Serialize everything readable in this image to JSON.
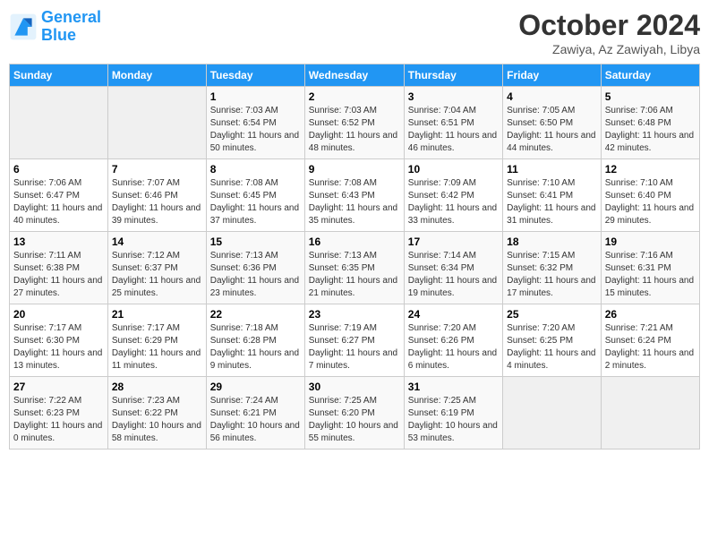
{
  "header": {
    "logo_line1": "General",
    "logo_line2": "Blue",
    "month_title": "October 2024",
    "subtitle": "Zawiya, Az Zawiyah, Libya"
  },
  "days_of_week": [
    "Sunday",
    "Monday",
    "Tuesday",
    "Wednesday",
    "Thursday",
    "Friday",
    "Saturday"
  ],
  "weeks": [
    [
      {
        "day": "",
        "info": ""
      },
      {
        "day": "",
        "info": ""
      },
      {
        "day": "1",
        "sunrise": "7:03 AM",
        "sunset": "6:54 PM",
        "daylight": "11 hours and 50 minutes."
      },
      {
        "day": "2",
        "sunrise": "7:03 AM",
        "sunset": "6:52 PM",
        "daylight": "11 hours and 48 minutes."
      },
      {
        "day": "3",
        "sunrise": "7:04 AM",
        "sunset": "6:51 PM",
        "daylight": "11 hours and 46 minutes."
      },
      {
        "day": "4",
        "sunrise": "7:05 AM",
        "sunset": "6:50 PM",
        "daylight": "11 hours and 44 minutes."
      },
      {
        "day": "5",
        "sunrise": "7:06 AM",
        "sunset": "6:48 PM",
        "daylight": "11 hours and 42 minutes."
      }
    ],
    [
      {
        "day": "6",
        "sunrise": "7:06 AM",
        "sunset": "6:47 PM",
        "daylight": "11 hours and 40 minutes."
      },
      {
        "day": "7",
        "sunrise": "7:07 AM",
        "sunset": "6:46 PM",
        "daylight": "11 hours and 39 minutes."
      },
      {
        "day": "8",
        "sunrise": "7:08 AM",
        "sunset": "6:45 PM",
        "daylight": "11 hours and 37 minutes."
      },
      {
        "day": "9",
        "sunrise": "7:08 AM",
        "sunset": "6:43 PM",
        "daylight": "11 hours and 35 minutes."
      },
      {
        "day": "10",
        "sunrise": "7:09 AM",
        "sunset": "6:42 PM",
        "daylight": "11 hours and 33 minutes."
      },
      {
        "day": "11",
        "sunrise": "7:10 AM",
        "sunset": "6:41 PM",
        "daylight": "11 hours and 31 minutes."
      },
      {
        "day": "12",
        "sunrise": "7:10 AM",
        "sunset": "6:40 PM",
        "daylight": "11 hours and 29 minutes."
      }
    ],
    [
      {
        "day": "13",
        "sunrise": "7:11 AM",
        "sunset": "6:38 PM",
        "daylight": "11 hours and 27 minutes."
      },
      {
        "day": "14",
        "sunrise": "7:12 AM",
        "sunset": "6:37 PM",
        "daylight": "11 hours and 25 minutes."
      },
      {
        "day": "15",
        "sunrise": "7:13 AM",
        "sunset": "6:36 PM",
        "daylight": "11 hours and 23 minutes."
      },
      {
        "day": "16",
        "sunrise": "7:13 AM",
        "sunset": "6:35 PM",
        "daylight": "11 hours and 21 minutes."
      },
      {
        "day": "17",
        "sunrise": "7:14 AM",
        "sunset": "6:34 PM",
        "daylight": "11 hours and 19 minutes."
      },
      {
        "day": "18",
        "sunrise": "7:15 AM",
        "sunset": "6:32 PM",
        "daylight": "11 hours and 17 minutes."
      },
      {
        "day": "19",
        "sunrise": "7:16 AM",
        "sunset": "6:31 PM",
        "daylight": "11 hours and 15 minutes."
      }
    ],
    [
      {
        "day": "20",
        "sunrise": "7:17 AM",
        "sunset": "6:30 PM",
        "daylight": "11 hours and 13 minutes."
      },
      {
        "day": "21",
        "sunrise": "7:17 AM",
        "sunset": "6:29 PM",
        "daylight": "11 hours and 11 minutes."
      },
      {
        "day": "22",
        "sunrise": "7:18 AM",
        "sunset": "6:28 PM",
        "daylight": "11 hours and 9 minutes."
      },
      {
        "day": "23",
        "sunrise": "7:19 AM",
        "sunset": "6:27 PM",
        "daylight": "11 hours and 7 minutes."
      },
      {
        "day": "24",
        "sunrise": "7:20 AM",
        "sunset": "6:26 PM",
        "daylight": "11 hours and 6 minutes."
      },
      {
        "day": "25",
        "sunrise": "7:20 AM",
        "sunset": "6:25 PM",
        "daylight": "11 hours and 4 minutes."
      },
      {
        "day": "26",
        "sunrise": "7:21 AM",
        "sunset": "6:24 PM",
        "daylight": "11 hours and 2 minutes."
      }
    ],
    [
      {
        "day": "27",
        "sunrise": "7:22 AM",
        "sunset": "6:23 PM",
        "daylight": "11 hours and 0 minutes."
      },
      {
        "day": "28",
        "sunrise": "7:23 AM",
        "sunset": "6:22 PM",
        "daylight": "10 hours and 58 minutes."
      },
      {
        "day": "29",
        "sunrise": "7:24 AM",
        "sunset": "6:21 PM",
        "daylight": "10 hours and 56 minutes."
      },
      {
        "day": "30",
        "sunrise": "7:25 AM",
        "sunset": "6:20 PM",
        "daylight": "10 hours and 55 minutes."
      },
      {
        "day": "31",
        "sunrise": "7:25 AM",
        "sunset": "6:19 PM",
        "daylight": "10 hours and 53 minutes."
      },
      {
        "day": "",
        "info": ""
      },
      {
        "day": "",
        "info": ""
      }
    ]
  ]
}
